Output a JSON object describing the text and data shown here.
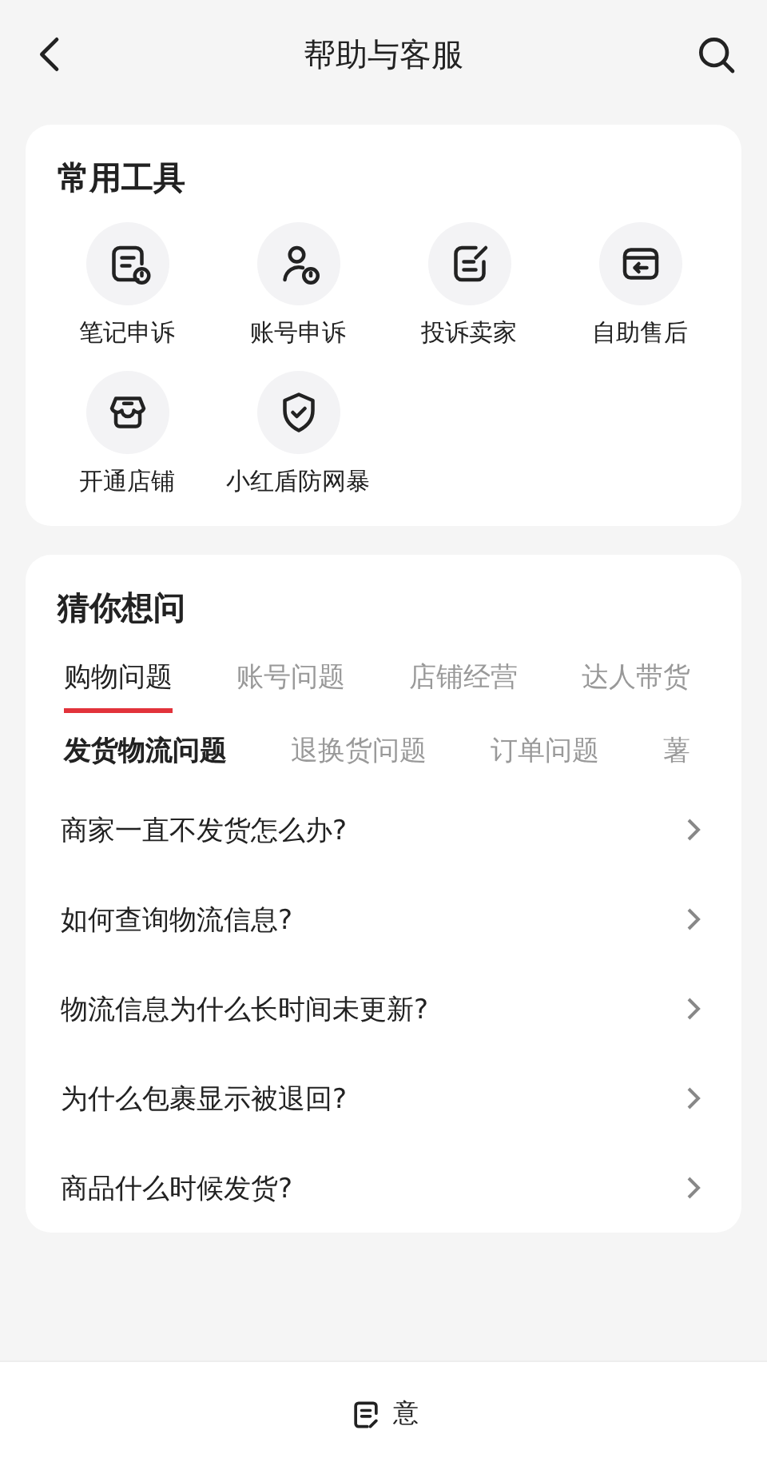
{
  "header": {
    "title": "帮助与客服"
  },
  "tools": {
    "title": "常用工具",
    "items": [
      {
        "label": "笔记申诉",
        "kind": "note-alert"
      },
      {
        "label": "账号申诉",
        "kind": "user-alert"
      },
      {
        "label": "投诉卖家",
        "kind": "edit"
      },
      {
        "label": "自助售后",
        "kind": "return"
      },
      {
        "label": "开通店铺",
        "kind": "store"
      },
      {
        "label": "小红盾防网暴",
        "kind": "shield"
      }
    ]
  },
  "faq": {
    "title": "猜你想问",
    "tabs": [
      {
        "label": "购物问题",
        "selected": true
      },
      {
        "label": "账号问题",
        "selected": false
      },
      {
        "label": "店铺经营",
        "selected": false
      },
      {
        "label": "达人带货",
        "selected": false
      }
    ],
    "subtabs": [
      {
        "label": "发货物流问题",
        "selected": true
      },
      {
        "label": "退换货问题",
        "selected": false
      },
      {
        "label": "订单问题",
        "selected": false
      },
      {
        "label": "薯",
        "selected": false
      }
    ],
    "questions": [
      "商家一直不发货怎么办?",
      "如何查询物流信息?",
      "物流信息为什么长时间未更新?",
      "为什么包裹显示被退回?",
      "商品什么时候发货?"
    ]
  },
  "bottom_bar": {
    "label": "意"
  }
}
